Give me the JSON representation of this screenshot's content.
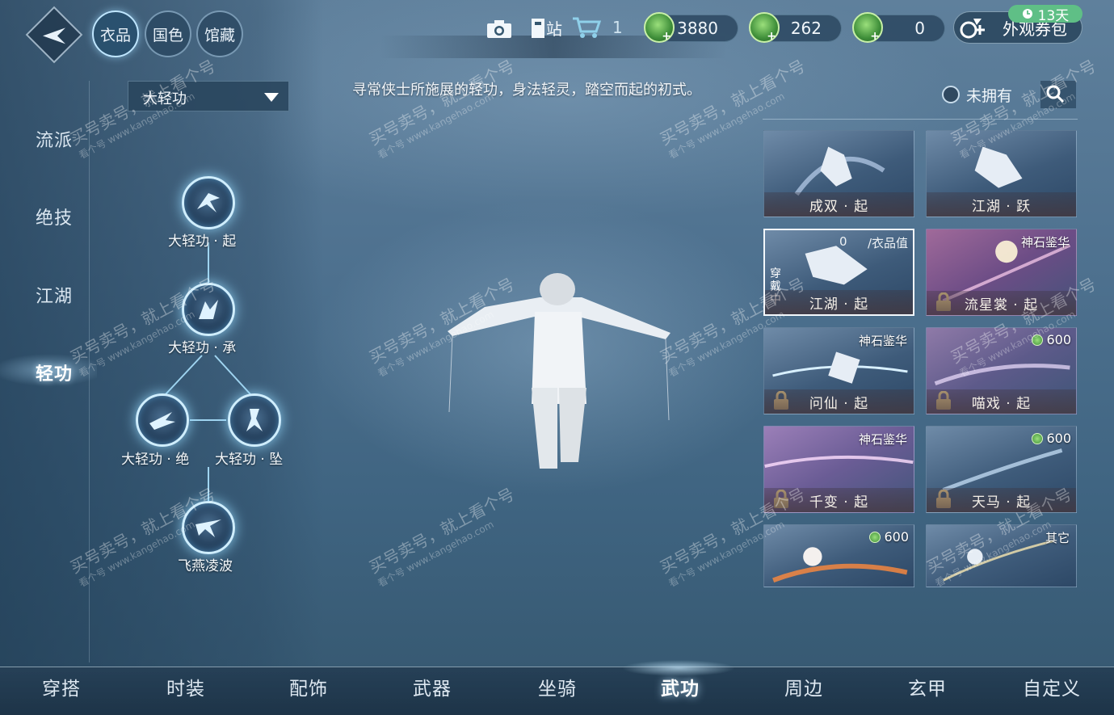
{
  "top_tabs": [
    {
      "label": "衣品",
      "active": true
    },
    {
      "label": "国色",
      "active": false
    },
    {
      "label": "馆藏",
      "active": false
    }
  ],
  "toolbar": {
    "station_label": "站",
    "cart_count": "1"
  },
  "currencies": [
    {
      "icon": "jade-coin-icon",
      "amount": "3880"
    },
    {
      "icon": "jade-coin-icon",
      "amount": "262"
    },
    {
      "icon": "jade-coin-icon",
      "amount": "0"
    }
  ],
  "appearance_pass": {
    "label": "外观券包",
    "timer": "13天"
  },
  "side_nav": [
    {
      "label": "流派",
      "active": false
    },
    {
      "label": "绝技",
      "active": false
    },
    {
      "label": "江湖",
      "active": false
    },
    {
      "label": "轻功",
      "active": true
    }
  ],
  "category_select": {
    "value": "大轻功"
  },
  "skill_tree": [
    {
      "label": "大轻功 · 起"
    },
    {
      "label": "大轻功 · 承"
    },
    {
      "label": "大轻功 · 绝"
    },
    {
      "label": "大轻功 · 坠"
    },
    {
      "label": "飞燕凌波"
    }
  ],
  "description": "寻常侠士所施展的轻功，身法轻灵，踏空而起的初式。",
  "filter": {
    "owned_label": "未拥有"
  },
  "cards": [
    {
      "name": "成双 · 起",
      "tag": "",
      "price": "",
      "locked": false,
      "selected": false
    },
    {
      "name": "江湖 · 跃",
      "tag": "",
      "price": "",
      "locked": false,
      "selected": false
    },
    {
      "name": "江湖 · 起",
      "tag": "",
      "price": "",
      "locked": false,
      "selected": true,
      "value_num": "0",
      "value_text": "/衣品值",
      "wearing": "穿戴中"
    },
    {
      "name": "流星裳 · 起",
      "tag": "神石鉴华",
      "price": "",
      "locked": true,
      "selected": false
    },
    {
      "name": "问仙 · 起",
      "tag": "神石鉴华",
      "price": "",
      "locked": true,
      "selected": false
    },
    {
      "name": "喵戏 · 起",
      "tag": "",
      "price": "600",
      "locked": true,
      "selected": false
    },
    {
      "name": "千变 · 起",
      "tag": "神石鉴华",
      "price": "",
      "locked": true,
      "selected": false
    },
    {
      "name": "天马 · 起",
      "tag": "",
      "price": "600",
      "locked": true,
      "selected": false
    },
    {
      "name": "",
      "tag": "",
      "price": "600",
      "locked": false,
      "selected": false
    },
    {
      "name": "",
      "tag": "其它",
      "price": "",
      "locked": false,
      "selected": false
    }
  ],
  "bottom_tabs": [
    {
      "label": "穿搭",
      "active": false
    },
    {
      "label": "时装",
      "active": false
    },
    {
      "label": "配饰",
      "active": false
    },
    {
      "label": "武器",
      "active": false
    },
    {
      "label": "坐骑",
      "active": false
    },
    {
      "label": "武功",
      "active": true
    },
    {
      "label": "周边",
      "active": false
    },
    {
      "label": "玄甲",
      "active": false
    },
    {
      "label": "自定义",
      "active": false
    }
  ],
  "watermark": {
    "main": "买号卖号，就上看个号",
    "sub": "看个号 www.kangehao.com"
  },
  "colors": {
    "accent": "#cfeeff",
    "coin": "#5fbf86",
    "panel": "#28445c"
  }
}
